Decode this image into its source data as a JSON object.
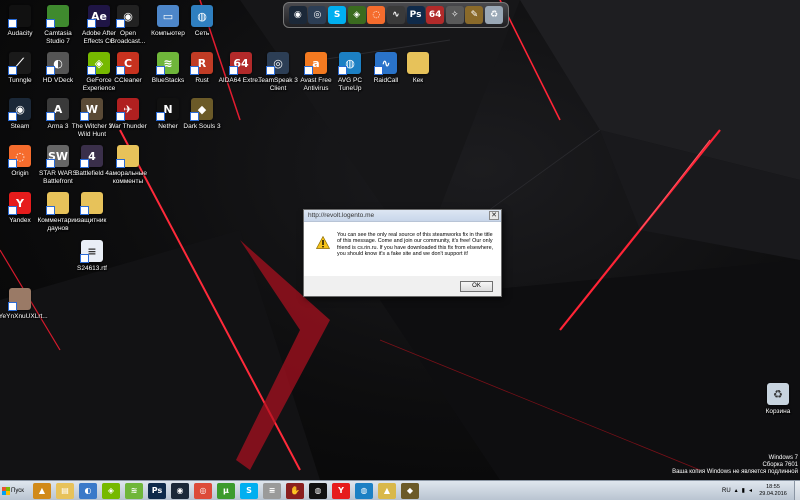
{
  "desktop_icons": [
    {
      "name": "icon-audacity",
      "label": "Audacity",
      "symbol": "",
      "bg": "#111111"
    },
    {
      "name": "icon-camtasia",
      "label": "Camtasia Studio 7",
      "symbol": "",
      "bg": "#3f8a2e"
    },
    {
      "name": "icon-after-effects",
      "label": "Adobe After Effects CC",
      "symbol": "Ae",
      "bg": "#1f1545"
    },
    {
      "name": "icon-obs",
      "label": "Open Broadcast...",
      "symbol": "◉",
      "bg": "#222222"
    },
    {
      "name": "icon-computer",
      "label": "Компьютер",
      "symbol": "▭",
      "bg": "#4d86c9"
    },
    {
      "name": "icon-network",
      "label": "Сеть",
      "symbol": "◍",
      "bg": "#2f7fbf"
    },
    {
      "name": "icon-tunngle",
      "label": "Tunngle",
      "symbol": "⟋",
      "bg": "#1a1a1a"
    },
    {
      "name": "icon-hd-vdeck",
      "label": "HD VDeck",
      "symbol": "◐",
      "bg": "#555555"
    },
    {
      "name": "icon-geforce",
      "label": "GeForce Experience",
      "symbol": "◈",
      "bg": "#76b900"
    },
    {
      "name": "icon-ccleaner",
      "label": "CCleaner",
      "symbol": "C",
      "bg": "#c7321f"
    },
    {
      "name": "icon-bluestacks",
      "label": "BlueStacks",
      "symbol": "≋",
      "bg": "#6fb63a"
    },
    {
      "name": "icon-rust",
      "label": "Rust",
      "symbol": "R",
      "bg": "#c13c25"
    },
    {
      "name": "icon-aida64",
      "label": "AIDA64 Extre...",
      "symbol": "64",
      "bg": "#b22a2a"
    },
    {
      "name": "icon-teamspeak",
      "label": "TeamSpeak 3 Client",
      "symbol": "◎",
      "bg": "#2c3e55"
    },
    {
      "name": "icon-avast",
      "label": "Avast Free Antivirus",
      "symbol": "a",
      "bg": "#f47a20"
    },
    {
      "name": "icon-avg",
      "label": "AVG PC TuneUp",
      "symbol": "◍",
      "bg": "#1c80c4"
    },
    {
      "name": "icon-raidcall",
      "label": "RaidCall",
      "symbol": "∿",
      "bg": "#2a73c9"
    },
    {
      "name": "icon-kek",
      "label": "Кек",
      "symbol": "",
      "bg": "#e7c25a"
    },
    {
      "name": "icon-steam",
      "label": "Steam",
      "symbol": "◉",
      "bg": "#1b2838"
    },
    {
      "name": "icon-arma3",
      "label": "Arma 3",
      "symbol": "A",
      "bg": "#3a3a3a"
    },
    {
      "name": "icon-witcher3",
      "label": "The Witcher 3 Wild Hunt",
      "symbol": "W",
      "bg": "#5a4a36"
    },
    {
      "name": "icon-war-thunder",
      "label": "War Thunder",
      "symbol": "✈",
      "bg": "#b02020"
    },
    {
      "name": "icon-nether",
      "label": "Nether",
      "symbol": "N",
      "bg": "#111111"
    },
    {
      "name": "icon-dark-souls3",
      "label": "Dark Souls 3",
      "symbol": "◆",
      "bg": "#6b5a28"
    },
    {
      "name": "icon-origin",
      "label": "Origin",
      "symbol": "◌",
      "bg": "#f56c2d"
    },
    {
      "name": "icon-star-wars",
      "label": "STAR WARS Battlefront",
      "symbol": "SW",
      "bg": "#666666"
    },
    {
      "name": "icon-battlefield4",
      "label": "Battlefield 4",
      "symbol": "4",
      "bg": "#3a2f4a"
    },
    {
      "name": "icon-amoral-comments",
      "label": "аморальные комменты",
      "symbol": "",
      "bg": "#e7c25a"
    },
    {
      "name": "icon-yandex",
      "label": "Yandex",
      "symbol": "Y",
      "bg": "#e61c1c"
    },
    {
      "name": "icon-comments-daunov",
      "label": "Комментарии даунов",
      "symbol": "",
      "bg": "#e7c25a"
    },
    {
      "name": "icon-zashchitnik",
      "label": "защитник",
      "symbol": "",
      "bg": "#e7c25a"
    },
    {
      "name": "icon-rtf-file",
      "label": "S24613.rtf",
      "symbol": "≡",
      "bg": "#e9eef6"
    },
    {
      "name": "icon-image-file",
      "label": "fYeYnXnuUXLrt...",
      "symbol": "",
      "bg": "#9a7a66"
    },
    {
      "name": "icon-recycle-bin",
      "label": "Корзина",
      "symbol": "♻",
      "bg": "#c8d4df"
    }
  ],
  "dock_items": [
    {
      "name": "dock-steam-icon",
      "symbol": "◉",
      "bg": "#1b2838"
    },
    {
      "name": "dock-teamspeak-icon",
      "symbol": "◎",
      "bg": "#2c3e55"
    },
    {
      "name": "dock-skype-icon",
      "symbol": "S",
      "bg": "#00aff0"
    },
    {
      "name": "dock-geforce-icon",
      "symbol": "◈",
      "bg": "#3a6b1f"
    },
    {
      "name": "dock-origin-icon",
      "symbol": "◌",
      "bg": "#f56c2d"
    },
    {
      "name": "dock-raidcall-icon",
      "symbol": "∿",
      "bg": "#3a3a3a"
    },
    {
      "name": "dock-photoshop-icon",
      "symbol": "Ps",
      "bg": "#0f2a4a"
    },
    {
      "name": "dock-aida64-icon",
      "symbol": "64",
      "bg": "#b22a2a"
    },
    {
      "name": "dock-tools-icon",
      "symbol": "✧",
      "bg": "#5a5a5a"
    },
    {
      "name": "dock-paint-icon",
      "symbol": "✎",
      "bg": "#8a6a2a"
    },
    {
      "name": "dock-recycle-icon",
      "symbol": "♻",
      "bg": "#9aa8b6"
    }
  ],
  "dialog": {
    "title": "http://revolt.logento.me",
    "close_label": "✕",
    "message": "You can see the only real source of this steamworks fix in the title of this message. Come and join our community, it's free! Our only friend is cs.rin.ru. If you have downloaded this fix from elsewhere, you should know it's a fake site and we don't support it!",
    "ok_label": "OK"
  },
  "watermark": {
    "line1": "Windows 7",
    "line2": "Сборка 7601",
    "line3": "Ваша копия Windows не является подлинной"
  },
  "taskbar": {
    "start_label": "Пуск",
    "items": [
      {
        "name": "taskbar-aimp-icon",
        "symbol": "▲",
        "bg": "#d18a1a"
      },
      {
        "name": "taskbar-explorer-icon",
        "symbol": "▤",
        "bg": "#e7c25a"
      },
      {
        "name": "taskbar-media-icon",
        "symbol": "◐",
        "bg": "#3a79c9"
      },
      {
        "name": "taskbar-nvidia-icon",
        "symbol": "◈",
        "bg": "#76b900"
      },
      {
        "name": "taskbar-bluestacks-icon",
        "symbol": "≋",
        "bg": "#6fb63a"
      },
      {
        "name": "taskbar-photoshop-icon",
        "symbol": "Ps",
        "bg": "#0f2a4a"
      },
      {
        "name": "taskbar-steam-icon",
        "symbol": "◉",
        "bg": "#1b2838"
      },
      {
        "name": "taskbar-chrome-icon",
        "symbol": "◎",
        "bg": "#dd4b39"
      },
      {
        "name": "taskbar-utorrent-icon",
        "symbol": "μ",
        "bg": "#3c9b2d"
      },
      {
        "name": "taskbar-skype-icon",
        "symbol": "S",
        "bg": "#00aff0"
      },
      {
        "name": "taskbar-vk-icon",
        "symbol": "≡",
        "bg": "#9a9a9a"
      },
      {
        "name": "taskbar-game-icon",
        "symbol": "✋",
        "bg": "#8a1f1f"
      },
      {
        "name": "taskbar-razer-icon",
        "symbol": "◍",
        "bg": "#111111"
      },
      {
        "name": "taskbar-yandex-icon",
        "symbol": "Y",
        "bg": "#e61c1c"
      },
      {
        "name": "taskbar-avg-icon",
        "symbol": "◍",
        "bg": "#1c80c4"
      },
      {
        "name": "taskbar-app-icon",
        "symbol": "▲",
        "bg": "#d9b84a"
      },
      {
        "name": "taskbar-darksouls-icon",
        "symbol": "◆",
        "bg": "#6b5a28"
      }
    ],
    "tray": {
      "language": "RU",
      "time": "18:55",
      "date": "29.04.2016"
    }
  }
}
